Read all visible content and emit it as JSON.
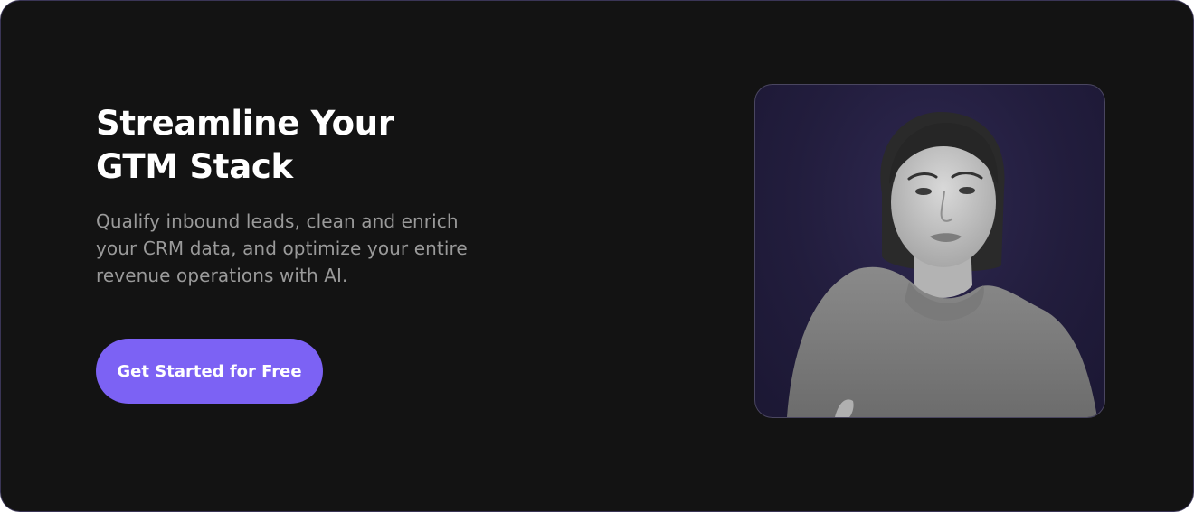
{
  "banner": {
    "headline_line1": "Streamline Your",
    "headline_line2": "GTM Stack",
    "subtext": "Qualify inbound leads, clean and enrich your CRM data, and optimize your entire revenue operations with AI.",
    "cta_label": "Get Started for Free"
  },
  "colors": {
    "background": "#131313",
    "accent": "#7c62f4",
    "headline": "#ffffff",
    "subtext": "#9a9a9a",
    "photo_backdrop": "#221d3d"
  },
  "icons": {
    "photo": "person-portrait-photo"
  }
}
